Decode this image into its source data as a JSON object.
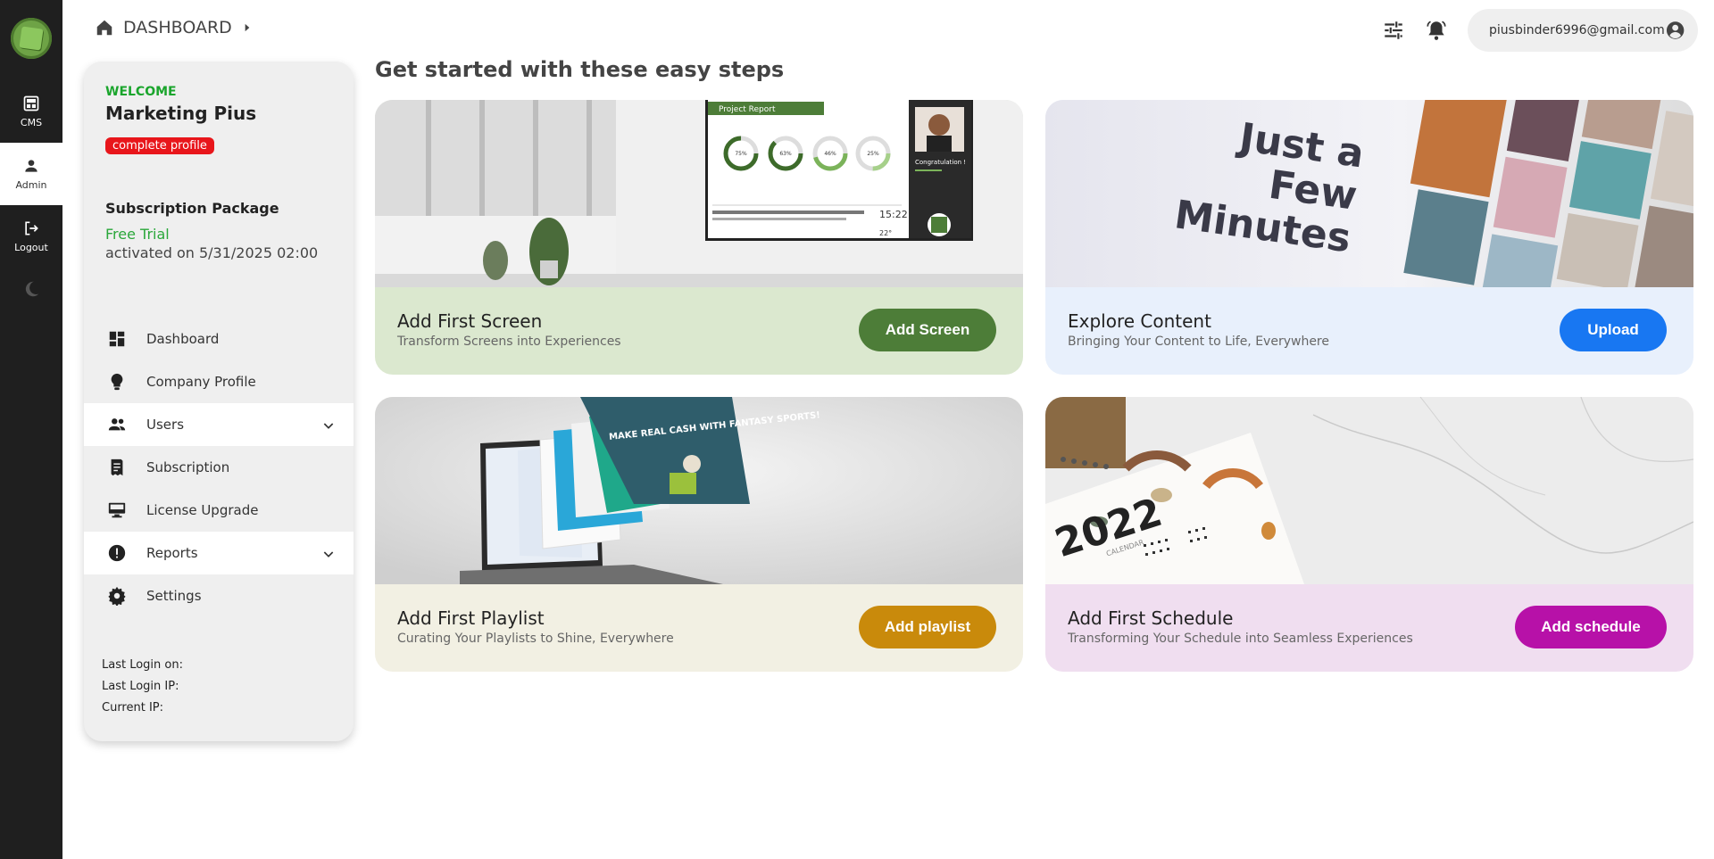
{
  "rail": {
    "items": [
      {
        "label": "CMS",
        "icon": "cms-icon"
      },
      {
        "label": "Admin",
        "icon": "person-icon"
      },
      {
        "label": "Logout",
        "icon": "logout-icon"
      }
    ],
    "theme_icon": "moon-icon"
  },
  "breadcrumb": {
    "label": "DASHBOARD"
  },
  "header": {
    "user_email": "piusbinder6996@gmail.com"
  },
  "profile": {
    "welcome": "WELCOME",
    "name": "Marketing Pius",
    "badge": "complete profile",
    "subscription_title": "Subscription Package",
    "plan": "Free Trial",
    "activated": "activated on 5/31/2025 02:00"
  },
  "menu": {
    "dashboard": "Dashboard",
    "company": "Company Profile",
    "users": "Users",
    "subscription": "Subscription",
    "license": "License Upgrade",
    "reports": "Reports",
    "settings": "Settings"
  },
  "login_info": {
    "last_login_on": "Last Login on:",
    "last_login_ip": "Last Login IP:",
    "current_ip": "Current IP:"
  },
  "main": {
    "heading": "Get started with these easy steps",
    "cards": [
      {
        "title": "Add First Screen",
        "subtitle": "Transform Screens into Experiences",
        "button": "Add Screen",
        "color": "#4d7d38"
      },
      {
        "title": "Explore Content",
        "subtitle": "Bringing Your Content to Life, Everywhere",
        "button": "Upload",
        "color": "#1877f2"
      },
      {
        "title": "Add First Playlist",
        "subtitle": "Curating Your Playlists to Shine, Everywhere",
        "button": "Add playlist",
        "color": "#c98a0b"
      },
      {
        "title": "Add First Schedule",
        "subtitle": "Transforming Your Schedule into Seamless Experiences",
        "button": "Add schedule",
        "color": "#b711a8"
      }
    ]
  },
  "card_images": {
    "screen": {
      "report_title": "Project Report",
      "percents": [
        "75%",
        "63%",
        "46%",
        "25%"
      ],
      "congrats": "Congratulation !",
      "time": "15:22",
      "temp": "22°"
    },
    "content": {
      "line1": "Just a",
      "line2": "Few",
      "line3": "Minutes"
    },
    "playlist": {
      "banner": "MAKE REAL CASH WITH FANTASY SPORTS!"
    },
    "schedule": {
      "year": "2022",
      "word": "CALENDAR"
    }
  }
}
